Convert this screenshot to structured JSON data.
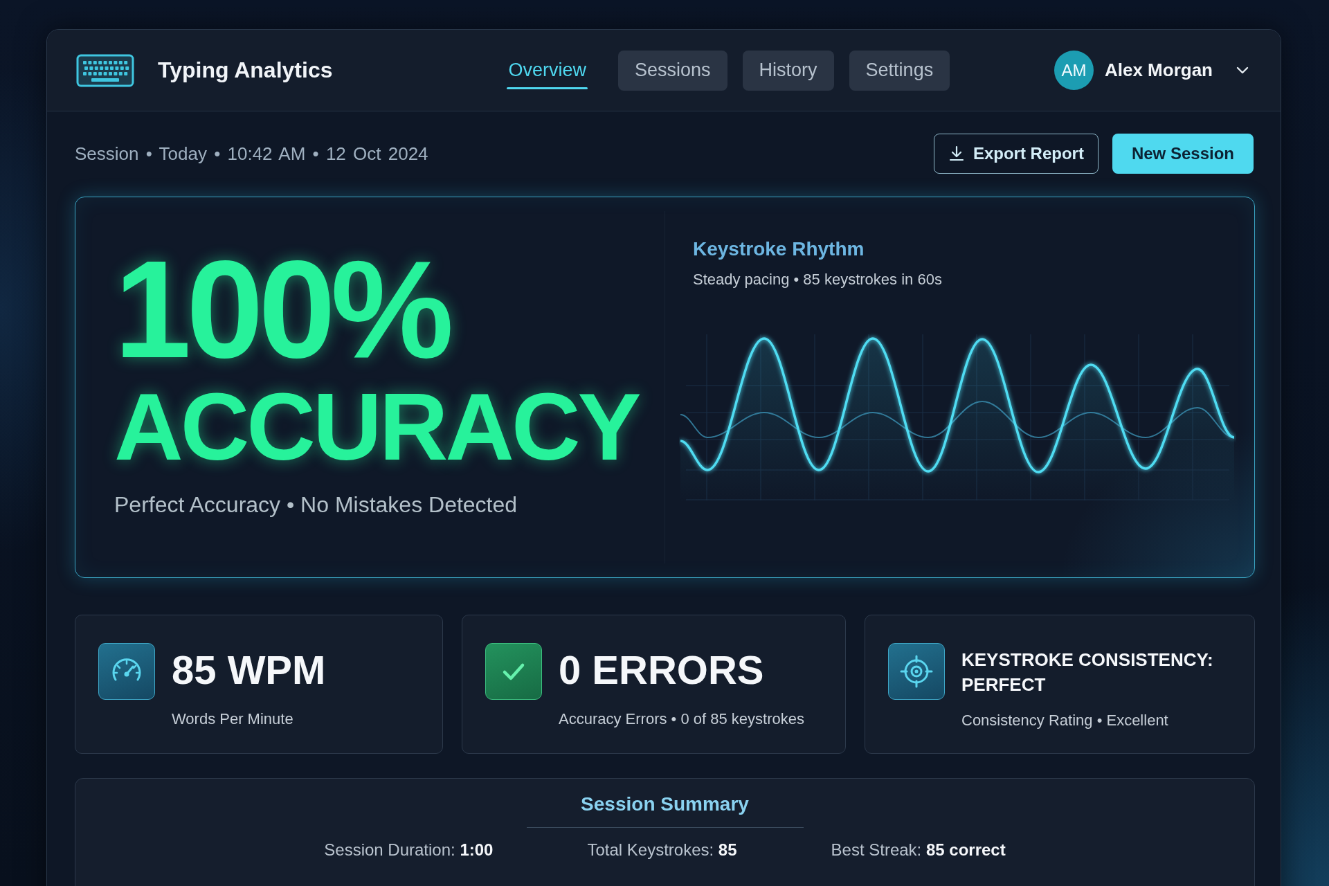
{
  "header": {
    "title": "Typing Analytics",
    "tabs": [
      {
        "label": "Overview",
        "selected": true
      },
      {
        "label": "Sessions",
        "selected": false
      },
      {
        "label": "History",
        "selected": false
      },
      {
        "label": "Settings",
        "selected": false
      }
    ],
    "user": {
      "initials": "AM",
      "name": "Alex Morgan"
    }
  },
  "session_info": "Session • Today • 10:42 AM • 12 Oct 2024",
  "actions": [
    {
      "label": "Export Report",
      "kind": "outline"
    },
    {
      "label": "New Session",
      "kind": "primary"
    }
  ],
  "hero": {
    "value": "100%",
    "label": "ACCURACY",
    "caption": "Perfect Accuracy • No Mistakes Detected",
    "rhythm": {
      "title": "Keystroke Rhythm",
      "subtitle": "Steady pacing • 85 keystrokes in 60s"
    }
  },
  "stats": [
    {
      "kind": "speed",
      "value": "85 WPM",
      "caption": "Words Per Minute"
    },
    {
      "kind": "errors",
      "value": "0 ERRORS",
      "caption": "Accuracy Errors • 0 of 85 keystrokes"
    },
    {
      "kind": "consistency",
      "value": "KEYSTROKE CONSISTENCY: PERFECT",
      "caption": "Consistency Rating • Excellent"
    }
  ],
  "summary": {
    "title": "Session Summary",
    "items": [
      "Session Duration: **1:00**",
      "Total Keystrokes: **85**",
      "Best Streak: **85 correct**"
    ]
  }
}
